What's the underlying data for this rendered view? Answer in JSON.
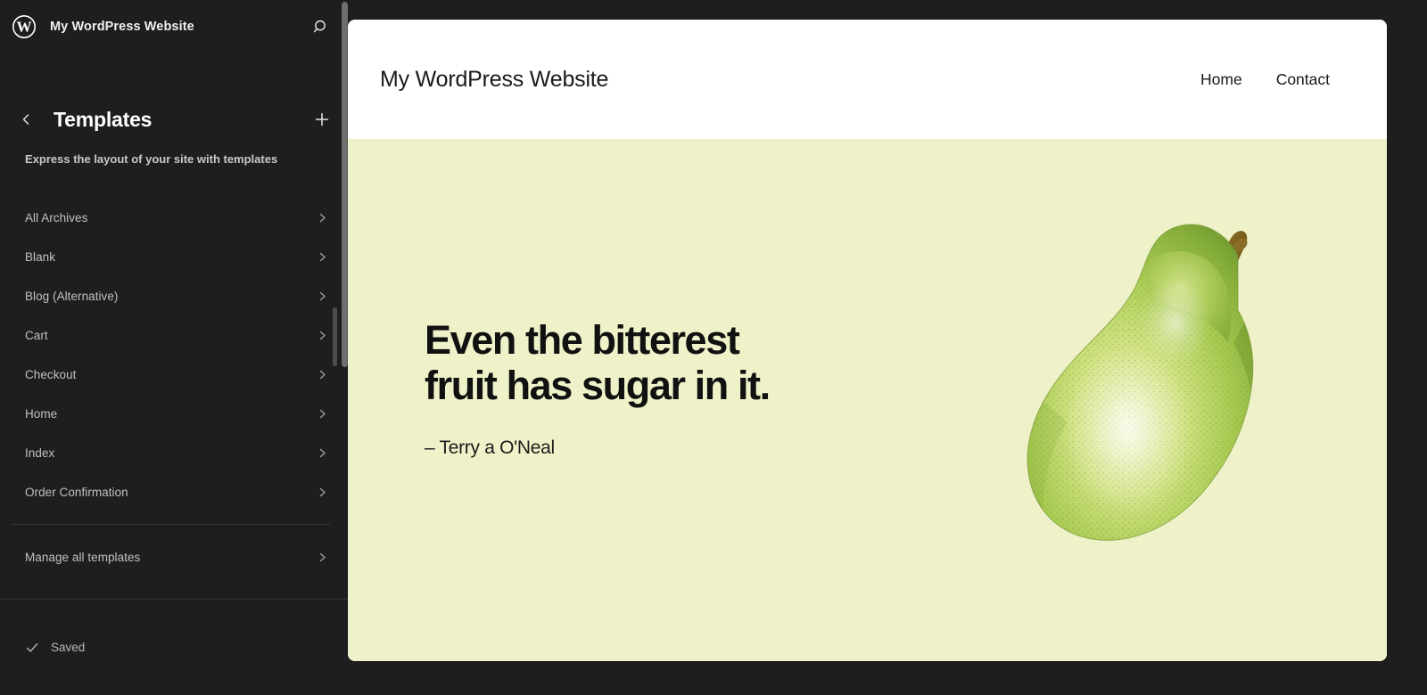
{
  "app": {
    "background": "#1e1e1e",
    "logo_icon": "wordpress-logo-icon",
    "site_title": "My WordPress Website",
    "search_icon": "search-icon"
  },
  "sidebar": {
    "back_icon": "chevron-left-icon",
    "panel_title": "Templates",
    "add_icon": "plus-icon",
    "panel_subtitle": "Express the layout of your site with templates",
    "chevron_icon": "chevron-right-icon",
    "templates": [
      {
        "label": "All Archives"
      },
      {
        "label": "Blank"
      },
      {
        "label": "Blog (Alternative)"
      },
      {
        "label": "Cart"
      },
      {
        "label": "Checkout"
      },
      {
        "label": "Home"
      },
      {
        "label": "Index"
      },
      {
        "label": "Order Confirmation"
      }
    ],
    "manage_all": {
      "label": "Manage all templates"
    },
    "footer": {
      "check_icon": "check-icon",
      "save_status": "Saved"
    },
    "scrollbar_outer": "sidebar-scrollbar",
    "scrollbar_inner": "template-list-scrollbar"
  },
  "preview": {
    "brand": "My WordPress Website",
    "nav": [
      {
        "label": "Home"
      },
      {
        "label": "Contact"
      }
    ],
    "hero": {
      "background": "#eff2c8",
      "quote": "Even the bitterest fruit has sugar in it.",
      "citation": "– Terry a O'Neal",
      "image_icon": "pear-illustration-image"
    }
  },
  "colors": {
    "sidebar_bg": "#1e1e1e",
    "sidebar_text": "#c0c0c0",
    "hero_bg": "#eff2c8",
    "pear_green": "#9dc34a",
    "pear_stem": "#7a5a1e"
  }
}
